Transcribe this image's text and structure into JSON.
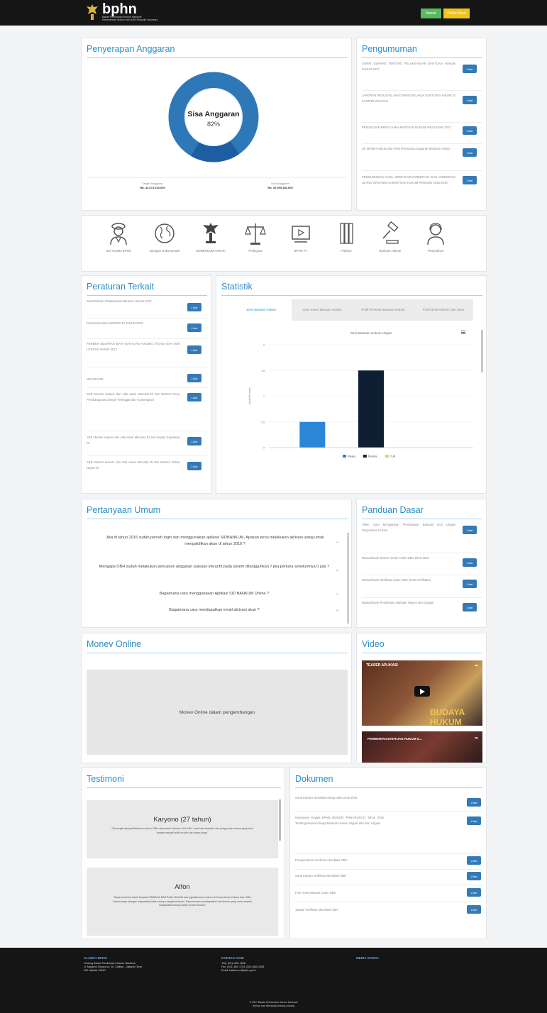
{
  "header": {
    "brand": "bphn",
    "sub_1": "Badan Pembinaan Hukum Nasional",
    "sub_2": "Kementerian Hukum dan HAM Republik Indonesia",
    "login_label": "Masuk",
    "register_label": "Daftar Akun"
  },
  "anggaran": {
    "title": "Penyerapan Anggaran",
    "center_label": "Sisa Anggaran",
    "center_pct": "82%",
    "remaining_fraction": 0.82,
    "left_label": "Target Anggaran",
    "left_value": "Rp. 44.674.340.000",
    "right_label": "Sisa Anggaran",
    "right_value": "Rp. 36.595.380.000",
    "color_remaining": "#2f78b8",
    "color_used": "#1d5ea2"
  },
  "pengumuman": {
    "title": "Pengumuman",
    "items": [
      {
        "text": "SURAT EDARAN TENTANG PELAKSANAAN BANTUAN HUKUM TAHUN 2017",
        "button": "Lihat"
      },
      {
        "text": "LAPORAN REALISASI ANGGARAN BELANJA BANTUAN HUKUM DI KANTOR WILAYAH",
        "button": "Lihat"
      },
      {
        "text": "PERJANJIAN KERJA SAMA BANTUAN HUKUM ANGGARAN 2017",
        "button": "Lihat"
      },
      {
        "text": "SK Menteri Hukum dan HAM RI tentang Anggaran Bantuan Hukum",
        "button": "Lihat"
      },
      {
        "text": "PENGUMUMAN HASIL VERIFIKASI/AKREDITASI DAN AKREDITASI ULANG ORGANISASI BANTUAN HUKUM PERIODE 2016-2018",
        "button": "Lihat"
      }
    ]
  },
  "menu": [
    {
      "label": "Dari Kepala BPHN",
      "icon": "person-speaker-icon"
    },
    {
      "label": "Jaringan Dokumentasi",
      "icon": "globe-icon"
    },
    {
      "label": "KEMENKUM HAM RI",
      "icon": "ministry-emblem-icon"
    },
    {
      "label": "Prolegnas",
      "icon": "scales-icon"
    },
    {
      "label": "BPHN TV",
      "icon": "tv-icon"
    },
    {
      "label": "e-library",
      "icon": "library-icon"
    },
    {
      "label": "Bantuan Hukum",
      "icon": "gavel-icon"
    },
    {
      "label": "Penyuluhan",
      "icon": "headset-person-icon"
    }
  ],
  "peraturan": {
    "title": "Peraturan Terkait",
    "items": [
      {
        "text": "Surat Edaran Pelaksanaan Bantuan Hukum 2017",
        "button": "Lihat"
      },
      {
        "text": "Permenkumham NOMOR 10 TAHUN 2015",
        "button": "Lihat"
      },
      {
        "text": "PERMEN BESARAN BIAYA BANTUAN HUKUM LITIGASI DAN NON LITIGASI TAHUN 2017",
        "button": "Lihat"
      },
      {
        "text": "MULTIPAGE",
        "button": "Lihat"
      },
      {
        "text": "SKB Menteri Hukum dan Hak Asasi Manusia RI dan Menteri Desa, Pembangunan Daerah Tertinggal dan Transmigrasi",
        "button": "Lihat"
      },
      {
        "text": "SKB Menteri Hukum dan Hak Asasi Manusia RI dan Kepala Kepolisian RI",
        "button": "Lihat"
      },
      {
        "text": "SKB Menteri Hukum dan Hak Asasi Manusia RI dan Menteri Dalam Negeri RI",
        "button": "Lihat"
      }
    ]
  },
  "statistik": {
    "title": "Statistik",
    "tabs": [
      "Jenis Bantuan Hukum",
      "Jenis Kasus Bantuan Hukum",
      "Profil Penerima Bantuan Hukum",
      "Profil Jenis Kelamin Dan Umur"
    ],
    "menu_icon": "hamburger-icon"
  },
  "chart_data": {
    "type": "bar",
    "title": "Jenis Bantuan Hukum Litigasi",
    "ylabel": "Jumlah Perkara",
    "categories": [
      "Pidana",
      "Perdata",
      "TUN"
    ],
    "values": [
      0.5,
      1.5,
      0
    ],
    "colors": [
      "#2b86d8",
      "#0f1f33",
      "#e6d84b"
    ],
    "ylim": [
      0,
      2
    ],
    "yticks": [
      "0",
      "0.5",
      "1",
      "1.5",
      "2"
    ],
    "legend": "bottom",
    "grid": true
  },
  "pertanyaan": {
    "title": "Pertanyaan Umum",
    "items": [
      "Jika di tahun 2015 sudah pernah login dan menggunakan aplikasi SIDBANKUM, Apakah perlu melakukan aktivasi ulang untuk mengaktifkan akun di tahun 2016 ?",
      "Mengapa OBH sudah melakukan pencairan anggaran putusan inkracht pada sistem ditangguhkan ? jika perkara sebelumnya 0 juta ?",
      "Bagaimana cara menggunakan Aplikasi SID BANKUM Online ?",
      "Bagaimana cara mendapatkan email aktivasi akun ?"
    ]
  },
  "panduan": {
    "title": "Panduan Dasar",
    "items": [
      {
        "text": "Video Cara Mengajukan Pembiayaan Bantuan Non Litigasi Penyuluhan Hukum",
        "button": "Lihat"
      },
      {
        "text": "Manual Book Sistem Verasi Calon OBH 2015-2018",
        "button": "Lihat"
      },
      {
        "text": "Manual Book Verifikasi Calon OBH (versi Verifikator)",
        "button": "Lihat"
      },
      {
        "text": "Manual Book Pembinaan Bantuan Hukum Non Litigasi",
        "button": "Lihat"
      }
    ]
  },
  "monev": {
    "title": "Monev Online",
    "message": "Monev Online dalam pengembangan"
  },
  "video": {
    "title": "Video",
    "clips": [
      {
        "caption": "TEASER APLIKASI",
        "overlay": "BUDAYA HUKUM"
      },
      {
        "caption": "PEMBERIAN BANTUAN HUKUM G..."
      }
    ]
  },
  "testimoni": {
    "title": "Testimoni",
    "entries": [
      {
        "name": "Karyono (27 tahun)",
        "quote": "\"Semenjak adanya Bantuan Hukum OBH maka kami terbantu oleh LBH, kami bisa terbantu dan pengurusan kasus yang kami hadapi menjadi lebih mudah dan tanpa biaya\""
      },
      {
        "name": "Alfon",
        "quote": "\"Saya berterima kasih kepada LEMBAGA BANTUAN HUKUM dan juga Bantuan Hukum di Kementerian Hukum dan HAM, karena saya sebagai masyarakat tidak mampu sangat terbantu. Saya merasa mendapatkan hak hukum yang sama seperti masyarakat lainnya dalam proses hukum\""
      }
    ]
  },
  "dokumen": {
    "title": "Dokumen",
    "items": [
      {
        "text": "Surat Edaran Akreditasi Ulang OBH 2016-2018",
        "button": "Lihat"
      },
      {
        "text": "Keputusan Kepala BPHN NOMOR: PHN-HN.03.03 Tahun 2015 Tentang Besaran Biaya Bantuan Hukum Litigasi dan Non Litigasi",
        "button": "Lihat"
      },
      {
        "text": "Pengumuman Verifikasi Akreditasi OBH",
        "button": "Lihat"
      },
      {
        "text": "Surat Edaran Verifikasi Akreditasi OBH",
        "button": "Lihat"
      },
      {
        "text": "Form Pemeriksaan Calon OBH",
        "button": "Lihat"
      },
      {
        "text": "Jadwal Verifikasi Akreditasi OBH",
        "button": "Lihat"
      }
    ]
  },
  "footer": {
    "alamat_title": "ALAMAT BPHN",
    "alamat_lines": [
      "Gedung Badan Pembinaan Hukum Nasional",
      "Jl. Mayjend Sutoyo no. 10, Cililitan - Jakarta Timur",
      "DKI Jakarta 13640"
    ],
    "kontak_title": "KONTAK KAMI",
    "kontak_lines": [
      "Telp: (021) 809 1908",
      "Fax: (021) 801 1753, (021) 800 2265",
      "Email: bankum.ri@bphn.go.id"
    ],
    "sosial_title": "MEDIA SOSIAL",
    "copy_1": "© 2017 Badan Pembinaan Hukum Nasional",
    "copy_2": "Semua hak dilindungi undang-undang"
  }
}
